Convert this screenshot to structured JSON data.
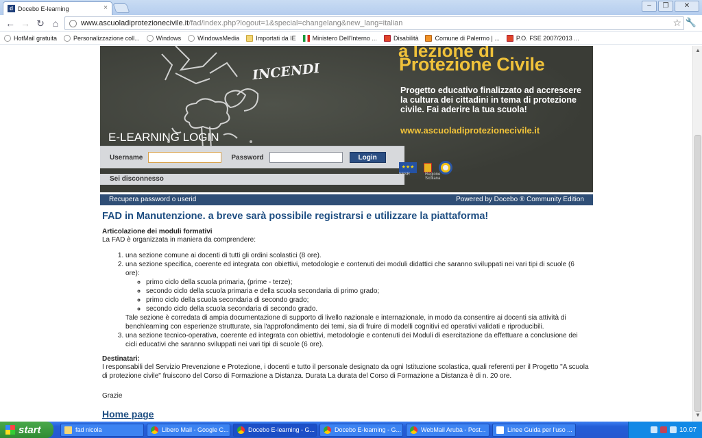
{
  "browser": {
    "tab_title": "Docebo E-learning",
    "tab_favicon_letter": "d",
    "url_domain": "www.ascuoladiprotezionecivile.it",
    "url_path": "/fad/index.php?logout=1&special=changelang&new_lang=italian",
    "bookmarks": [
      {
        "label": "HotMail gratuita",
        "icon": "globe-icon"
      },
      {
        "label": "Personalizzazione coll...",
        "icon": "globe-icon"
      },
      {
        "label": "Windows",
        "icon": "globe-icon"
      },
      {
        "label": "WindowsMedia",
        "icon": "globe-icon"
      },
      {
        "label": "Importati da IE",
        "icon": "folder-icon"
      },
      {
        "label": "Ministero Dell'Interno ...",
        "icon": "italy-flag-icon"
      },
      {
        "label": "Disabilità",
        "icon": "red-icon"
      },
      {
        "label": "Comune di Palermo | ...",
        "icon": "orange-icon"
      },
      {
        "label": "P.O. FSE 2007/2013 ...",
        "icon": "red-icon"
      }
    ]
  },
  "banner": {
    "heading_top": "a lezione di",
    "heading": "Protezione Civile",
    "description": "Progetto educativo finalizzato ad accrescere la cultura dei cittadini in tema di protezione civile. Fai aderire la tua scuola!",
    "site": "www.ascuoladiprotezionecivile.it",
    "chalk_word": "INCENDI",
    "elearning_title": "E-LEARNING LOGIN"
  },
  "login": {
    "username_label": "Username",
    "password_label": "Password",
    "login_button": "Login",
    "status": "Sei disconnesso"
  },
  "logos": {
    "eu_label": "FESR",
    "region_label": "Regione Siciliana"
  },
  "bluebar": {
    "recover": "Recupera password o userid",
    "powered": "Powered by Docebo ® Community Edition"
  },
  "content": {
    "title": "FAD in Manutenzione. a breve sarà possibile registrarsi e utilizzare la piattaforma!",
    "section_heading": "Articolazione dei moduli formativi",
    "intro": "La FAD è organizzata in maniera da comprendere:",
    "item1": "una sezione comune ai docenti di tutti gli ordini scolastici (8 ore).",
    "item2": "una sezione specifica, coerente ed integrata con obiettivi, metodologie e contenuti dei moduli didattici che saranno sviluppati nei vari tipi di scuole (6 ore):",
    "subitems": [
      "primo ciclo della scuola primaria, (prime - terze);",
      "secondo ciclo della scuola primaria e della scuola secondaria di primo grado;",
      "primo ciclo della scuola secondaria di secondo grado;",
      "secondo ciclo della scuola secondaria di secondo grado."
    ],
    "item2_note": "Tale sezione è corredata di ampia documentazione di supporto di livello nazionale e internazionale, in modo da consentire ai docenti sia attività di benchlearning con esperienze strutturate, sia l'approfondimento dei temi, sia di fruire di modelli cognitivi ed operativi validati e riproducibili.",
    "item3": "una sezione tecnico-operativa, coerente ed integrata con obiettivi, metodologie e contenuti dei Moduli di esercitazione da effettuare a conclusione dei cicli educativi che saranno sviluppati nei vari tipi di scuole (6 ore).",
    "dest_heading": "Destinatari:",
    "dest_text": "I responsabili del Servizio Prevenzione e Protezione, i docenti e tutto il personale designato da ogni Istituzione scolastica, quali referenti per il Progetto \"A scuola di protezione civile\" fruiscono del Corso di Formazione a Distanza. Durata La durata del Corso di Formazione a Distanza è di n. 20 ore.",
    "thanks": "Grazie",
    "home_link": "Home page"
  },
  "taskbar": {
    "start": "start",
    "tasks": [
      {
        "label": "fad nicola",
        "icon": "folder-icon"
      },
      {
        "label": "Libero Mail - Google C...",
        "icon": "chrome-icon"
      },
      {
        "label": "Docebo E-learning - G...",
        "icon": "chrome-icon",
        "active": true
      },
      {
        "label": "Docebo E-learning - G...",
        "icon": "chrome-icon"
      },
      {
        "label": "WebMail Aruba - Post...",
        "icon": "chrome-icon"
      },
      {
        "label": "Linee Guida per l'uso ...",
        "icon": "document-icon"
      }
    ],
    "clock": "10.07"
  }
}
